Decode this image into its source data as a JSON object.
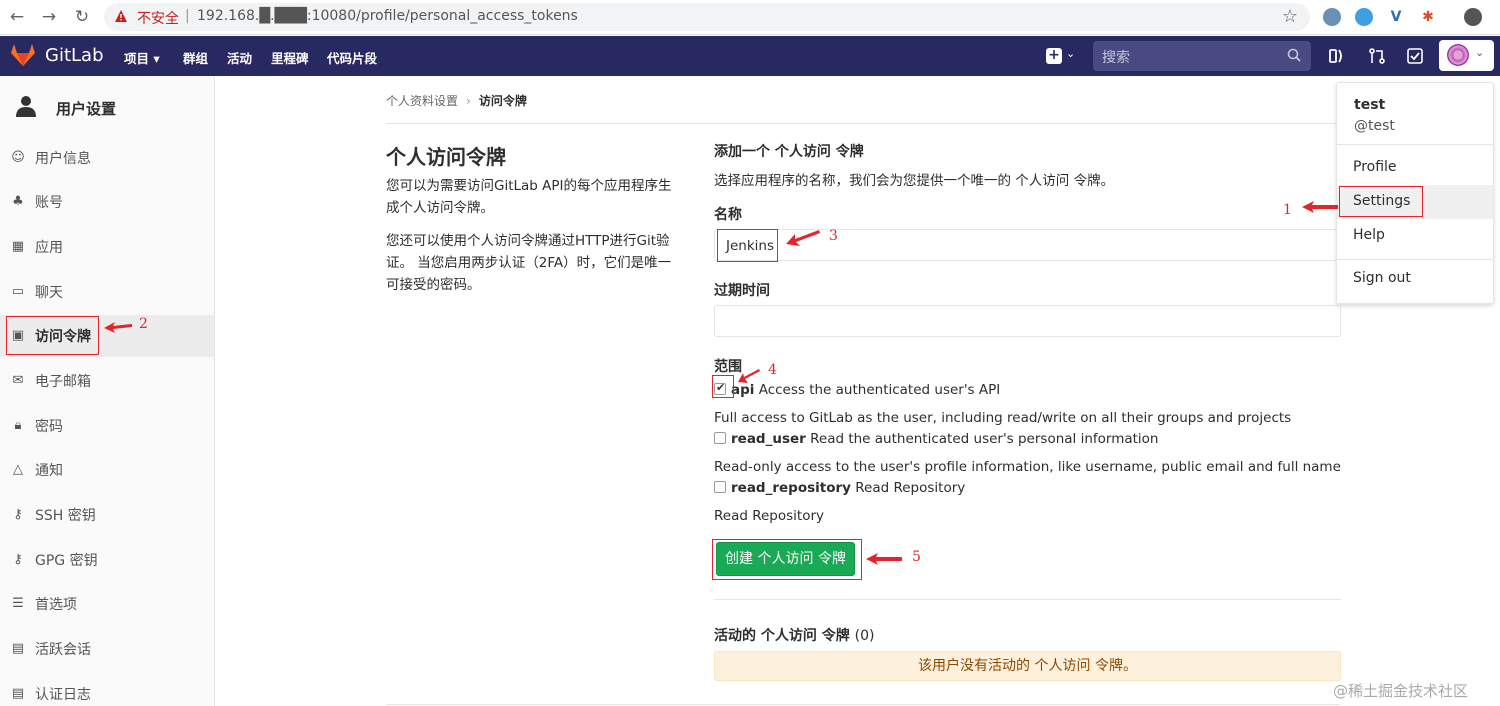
{
  "browser": {
    "insecure_label": "不安全",
    "url": "192.168.█.███:10080/profile/personal_access_tokens"
  },
  "topnav": {
    "brand": "GitLab",
    "links": [
      "项目 ▾",
      "群组",
      "活动",
      "里程碑",
      "代码片段"
    ],
    "search_placeholder": "搜索"
  },
  "sidebar": {
    "title": "用户设置",
    "items": [
      {
        "label": "用户信息",
        "icon": "profile-icon"
      },
      {
        "label": "账号",
        "icon": "account-icon"
      },
      {
        "label": "应用",
        "icon": "applications-icon"
      },
      {
        "label": "聊天",
        "icon": "chat-icon"
      },
      {
        "label": "访问令牌",
        "icon": "token-icon"
      },
      {
        "label": "电子邮箱",
        "icon": "email-icon"
      },
      {
        "label": "密码",
        "icon": "lock-icon"
      },
      {
        "label": "通知",
        "icon": "bell-icon"
      },
      {
        "label": "SSH 密钥",
        "icon": "key-icon"
      },
      {
        "label": "GPG 密钥",
        "icon": "key-icon"
      },
      {
        "label": "首选项",
        "icon": "preferences-icon"
      },
      {
        "label": "活跃会话",
        "icon": "sessions-icon"
      },
      {
        "label": "认证日志",
        "icon": "log-icon"
      }
    ]
  },
  "breadcrumb": {
    "parent": "个人资料设置",
    "current": "访问令牌"
  },
  "left": {
    "title": "个人访问令牌",
    "p1": "您可以为需要访问GitLab API的每个应用程序生成个人访问令牌。",
    "p2": "您还可以使用个人访问令牌通过HTTP进行Git验证。 当您启用两步认证（2FA）时，它们是唯一可接受的密码。"
  },
  "form": {
    "title": "添加一个 个人访问 令牌",
    "description": "选择应用程序的名称，我们会为您提供一个唯一的 个人访问 令牌。",
    "name_label": "名称",
    "name_value": "Jenkins",
    "expiry_label": "过期时间",
    "scopes_label": "范围",
    "scopes": [
      {
        "name": "api",
        "summary": "Access the authenticated user's API",
        "detail": "Full access to GitLab as the user, including read/write on all their groups and projects",
        "checked": true
      },
      {
        "name": "read_user",
        "summary": "Read the authenticated user's personal information",
        "detail": "Read-only access to the user's profile information, like username, public email and full name",
        "checked": false
      },
      {
        "name": "read_repository",
        "summary": "Read Repository",
        "detail": "Read Repository",
        "checked": false
      }
    ],
    "submit_label": "创建 个人访问 令牌"
  },
  "active_tokens": {
    "title": "活动的 个人访问 令牌",
    "count": "(0)",
    "empty_message": "该用户没有活动的 个人访问 令牌。"
  },
  "user_menu": {
    "name": "test",
    "handle": "@test",
    "items": [
      "Profile",
      "Settings",
      "Help",
      "Sign out"
    ]
  },
  "annotations": [
    "1",
    "2",
    "3",
    "4",
    "5"
  ],
  "watermark": "@稀土掘金技术社区",
  "colors": {
    "nav_bg": "#292961",
    "primary_green": "#1aaa55",
    "annotation_red": "#e0262b",
    "notice_bg": "#fdf1dd"
  }
}
